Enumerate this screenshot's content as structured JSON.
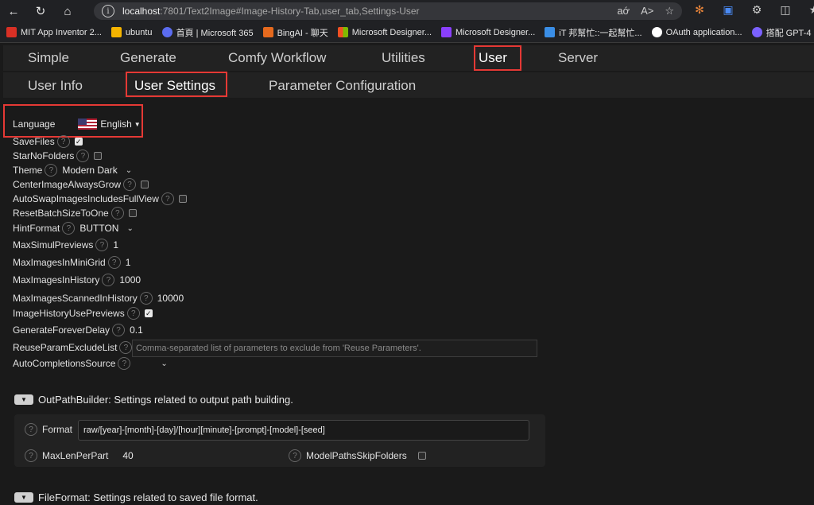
{
  "browser": {
    "url_host": "localhost",
    "url_path": ":7801/Text2Image#Image-History-Tab,user_tab,Settings-User",
    "bookmarks": [
      {
        "label": "MIT App Inventor 2...",
        "color": "#d93025"
      },
      {
        "label": "ubuntu",
        "color": "#f5b400"
      },
      {
        "label": "首頁 | Microsoft 365",
        "color": "#5b6cf0"
      },
      {
        "label": "BingAI - 聊天",
        "color": "#e66a1e"
      },
      {
        "label": "Microsoft Designer...",
        "color": "#00a4ef"
      },
      {
        "label": "Microsoft Designer...",
        "color": "#8a3ffc"
      },
      {
        "label": "iT 邦幫忙::一起幫忙...",
        "color": "#3a8ee6"
      },
      {
        "label": "OAuth application...",
        "color": "#ffffff"
      },
      {
        "label": "搭配 GPT-4 的 Bing...",
        "color": "#7b61ff"
      }
    ]
  },
  "tabs_main": [
    "Simple",
    "Generate",
    "Comfy Workflow",
    "Utilities",
    "User",
    "Server"
  ],
  "tabs_sub": [
    "User Info",
    "User Settings",
    "Parameter Configuration"
  ],
  "language": {
    "label": "Language",
    "value": "English"
  },
  "settings": {
    "save_files": "SaveFiles",
    "star_no_folders": "StarNoFolders",
    "theme": "Theme",
    "theme_value": "Modern Dark",
    "center_image": "CenterImageAlwaysGrow",
    "auto_swap": "AutoSwapImagesIncludesFullView",
    "reset_batch": "ResetBatchSizeToOne",
    "hint_format": "HintFormat",
    "hint_format_value": "BUTTON",
    "max_simul": "MaxSimulPreviews",
    "max_simul_value": "1",
    "max_minigrid": "MaxImagesInMiniGrid",
    "max_minigrid_value": "1",
    "max_history": "MaxImagesInHistory",
    "max_history_value": "1000",
    "max_scanned": "MaxImagesScannedInHistory",
    "max_scanned_value": "10000",
    "history_previews": "ImageHistoryUsePreviews",
    "forever_delay": "GenerateForeverDelay",
    "forever_delay_value": "0.1",
    "reuse_exclude": "ReuseParamExcludeList",
    "reuse_exclude_placeholder": "Comma-separated list of parameters to exclude from 'Reuse Parameters'.",
    "autocomplete": "AutoCompletionsSource"
  },
  "outpath": {
    "title": "OutPathBuilder: Settings related to output path building.",
    "format_label": "Format",
    "format_value": "raw/[year]-[month]-[day]/[hour][minute]-[prompt]-[model]-[seed]",
    "maxlen_label": "MaxLenPerPart",
    "maxlen_value": "40",
    "skip_label": "ModelPathsSkipFolders"
  },
  "fileformat": {
    "title": "FileFormat: Settings related to saved file format."
  }
}
